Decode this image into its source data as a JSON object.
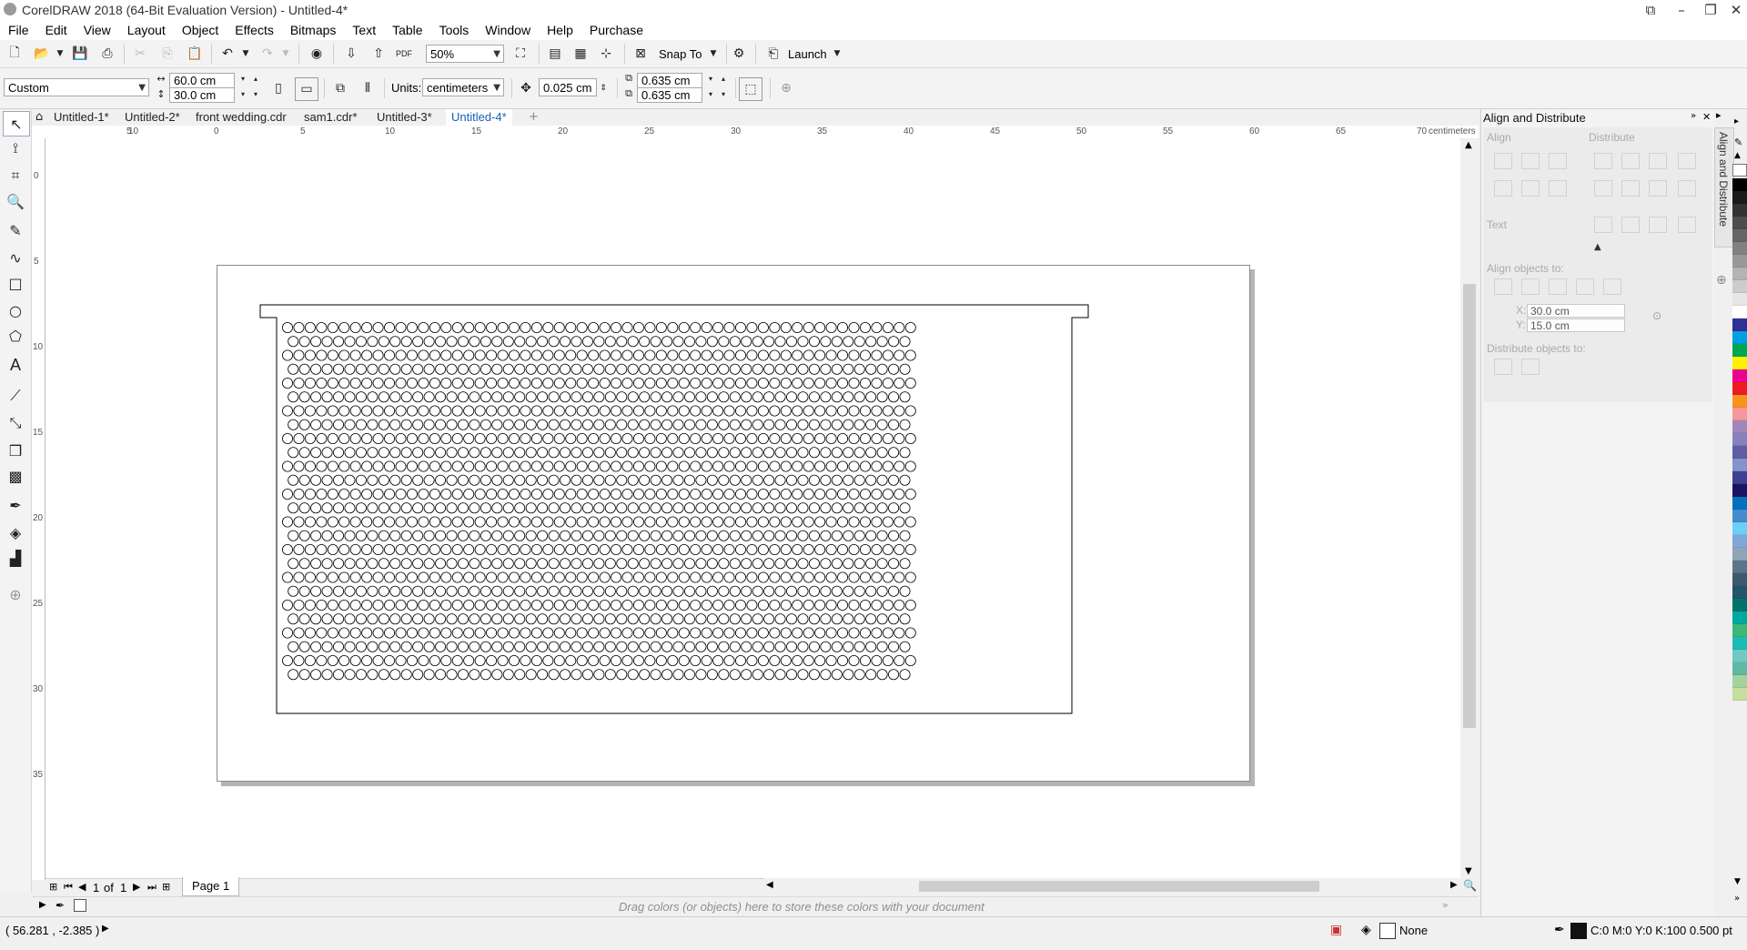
{
  "window": {
    "title": "CorelDRAW 2018 (64-Bit Evaluation Version) - Untitled-4*",
    "controls": [
      "restore-icon",
      "minimize-icon",
      "maximize-icon",
      "close-icon"
    ]
  },
  "menu": [
    "File",
    "Edit",
    "View",
    "Layout",
    "Object",
    "Effects",
    "Bitmaps",
    "Text",
    "Table",
    "Tools",
    "Window",
    "Help",
    "Purchase"
  ],
  "standard_toolbar": {
    "zoom": "50%",
    "snap_to": "Snap To",
    "launch": "Launch",
    "pdf_label": "PDF"
  },
  "property_bar": {
    "preset": "Custom",
    "width": "60.0 cm",
    "height": "30.0 cm",
    "units_label": "Units:",
    "units": "centimeters",
    "nudge": "0.025 cm",
    "dup_x": "0.635 cm",
    "dup_y": "0.635 cm"
  },
  "document_tabs": [
    {
      "label": "Untitled-1*",
      "active": false
    },
    {
      "label": "Untitled-2*",
      "active": false
    },
    {
      "label": "front wedding.cdr",
      "active": false
    },
    {
      "label": "sam1.cdr*",
      "active": false
    },
    {
      "label": "Untitled-3*",
      "active": false
    },
    {
      "label": "Untitled-4*",
      "active": true
    }
  ],
  "ruler": {
    "units": "centimeters",
    "h_labels": [
      "10",
      "5",
      "0",
      "5",
      "10",
      "15",
      "20",
      "25",
      "30",
      "35",
      "40",
      "45",
      "50",
      "55",
      "60",
      "65",
      "70"
    ],
    "v_labels": [
      "0",
      "5",
      "10",
      "15",
      "20",
      "25",
      "30",
      "35"
    ]
  },
  "page_navigation": {
    "current": "1",
    "of": "of",
    "total": "1",
    "page_tab": "Page 1"
  },
  "document_palette_hint": "Drag colors (or objects) here to store these colors with your document",
  "status": {
    "coordinates": "( 56.281 , -2.385 )",
    "fill": "None",
    "outline": "C:0 M:0 Y:0 K:100  0.500 pt"
  },
  "docker": {
    "title": "Align and Distribute",
    "tab_label": "Align and Distribute",
    "align_label": "Align",
    "distribute_label": "Distribute",
    "text_label": "Text",
    "align_to_label": "Align objects to:",
    "x_label": "X:",
    "y_label": "Y:",
    "x_value": "30.0 cm",
    "y_value": "15.0 cm",
    "distribute_to_label": "Distribute objects to:"
  },
  "palette_colors": [
    "#000000",
    "#1a1a1a",
    "#333333",
    "#4d4d4d",
    "#666666",
    "#808080",
    "#999999",
    "#b3b3b3",
    "#cccccc",
    "#e6e6e6",
    "#ffffff",
    "#2e3192",
    "#00a0e3",
    "#00a651",
    "#fff200",
    "#ec008c",
    "#ed1c24",
    "#f7941d",
    "#f5989d",
    "#a186be",
    "#8781bd",
    "#605ca8",
    "#8493ca",
    "#3e4095",
    "#1b1464",
    "#0072bc",
    "#448ccb",
    "#6dcff6",
    "#7da7d9",
    "#8fa5b4",
    "#5a7489",
    "#3d5a6c",
    "#24546b",
    "#00746b",
    "#00a99d",
    "#3cb878",
    "#1cbbb4",
    "#71c8c4",
    "#5fb8a3",
    "#a3d39c",
    "#c4df9b"
  ],
  "toolbox_tools": [
    "pick-tool-icon",
    "shape-tool-icon",
    "crop-tool-icon",
    "zoom-tool-icon",
    "freehand-tool-icon",
    "artistic-media-icon",
    "rectangle-tool-icon",
    "ellipse-tool-icon",
    "polygon-tool-icon",
    "text-tool-icon",
    "parallel-dimension-icon",
    "connector-tool-icon",
    "drop-shadow-icon",
    "transparency-icon",
    "eyedropper-icon",
    "interactive-fill-icon",
    "smart-fill-icon",
    "add-tool-icon"
  ],
  "drawing": {
    "description_shape": "tray",
    "circle_rows": 26,
    "circle_cols": 56,
    "stroke": "#000000"
  }
}
